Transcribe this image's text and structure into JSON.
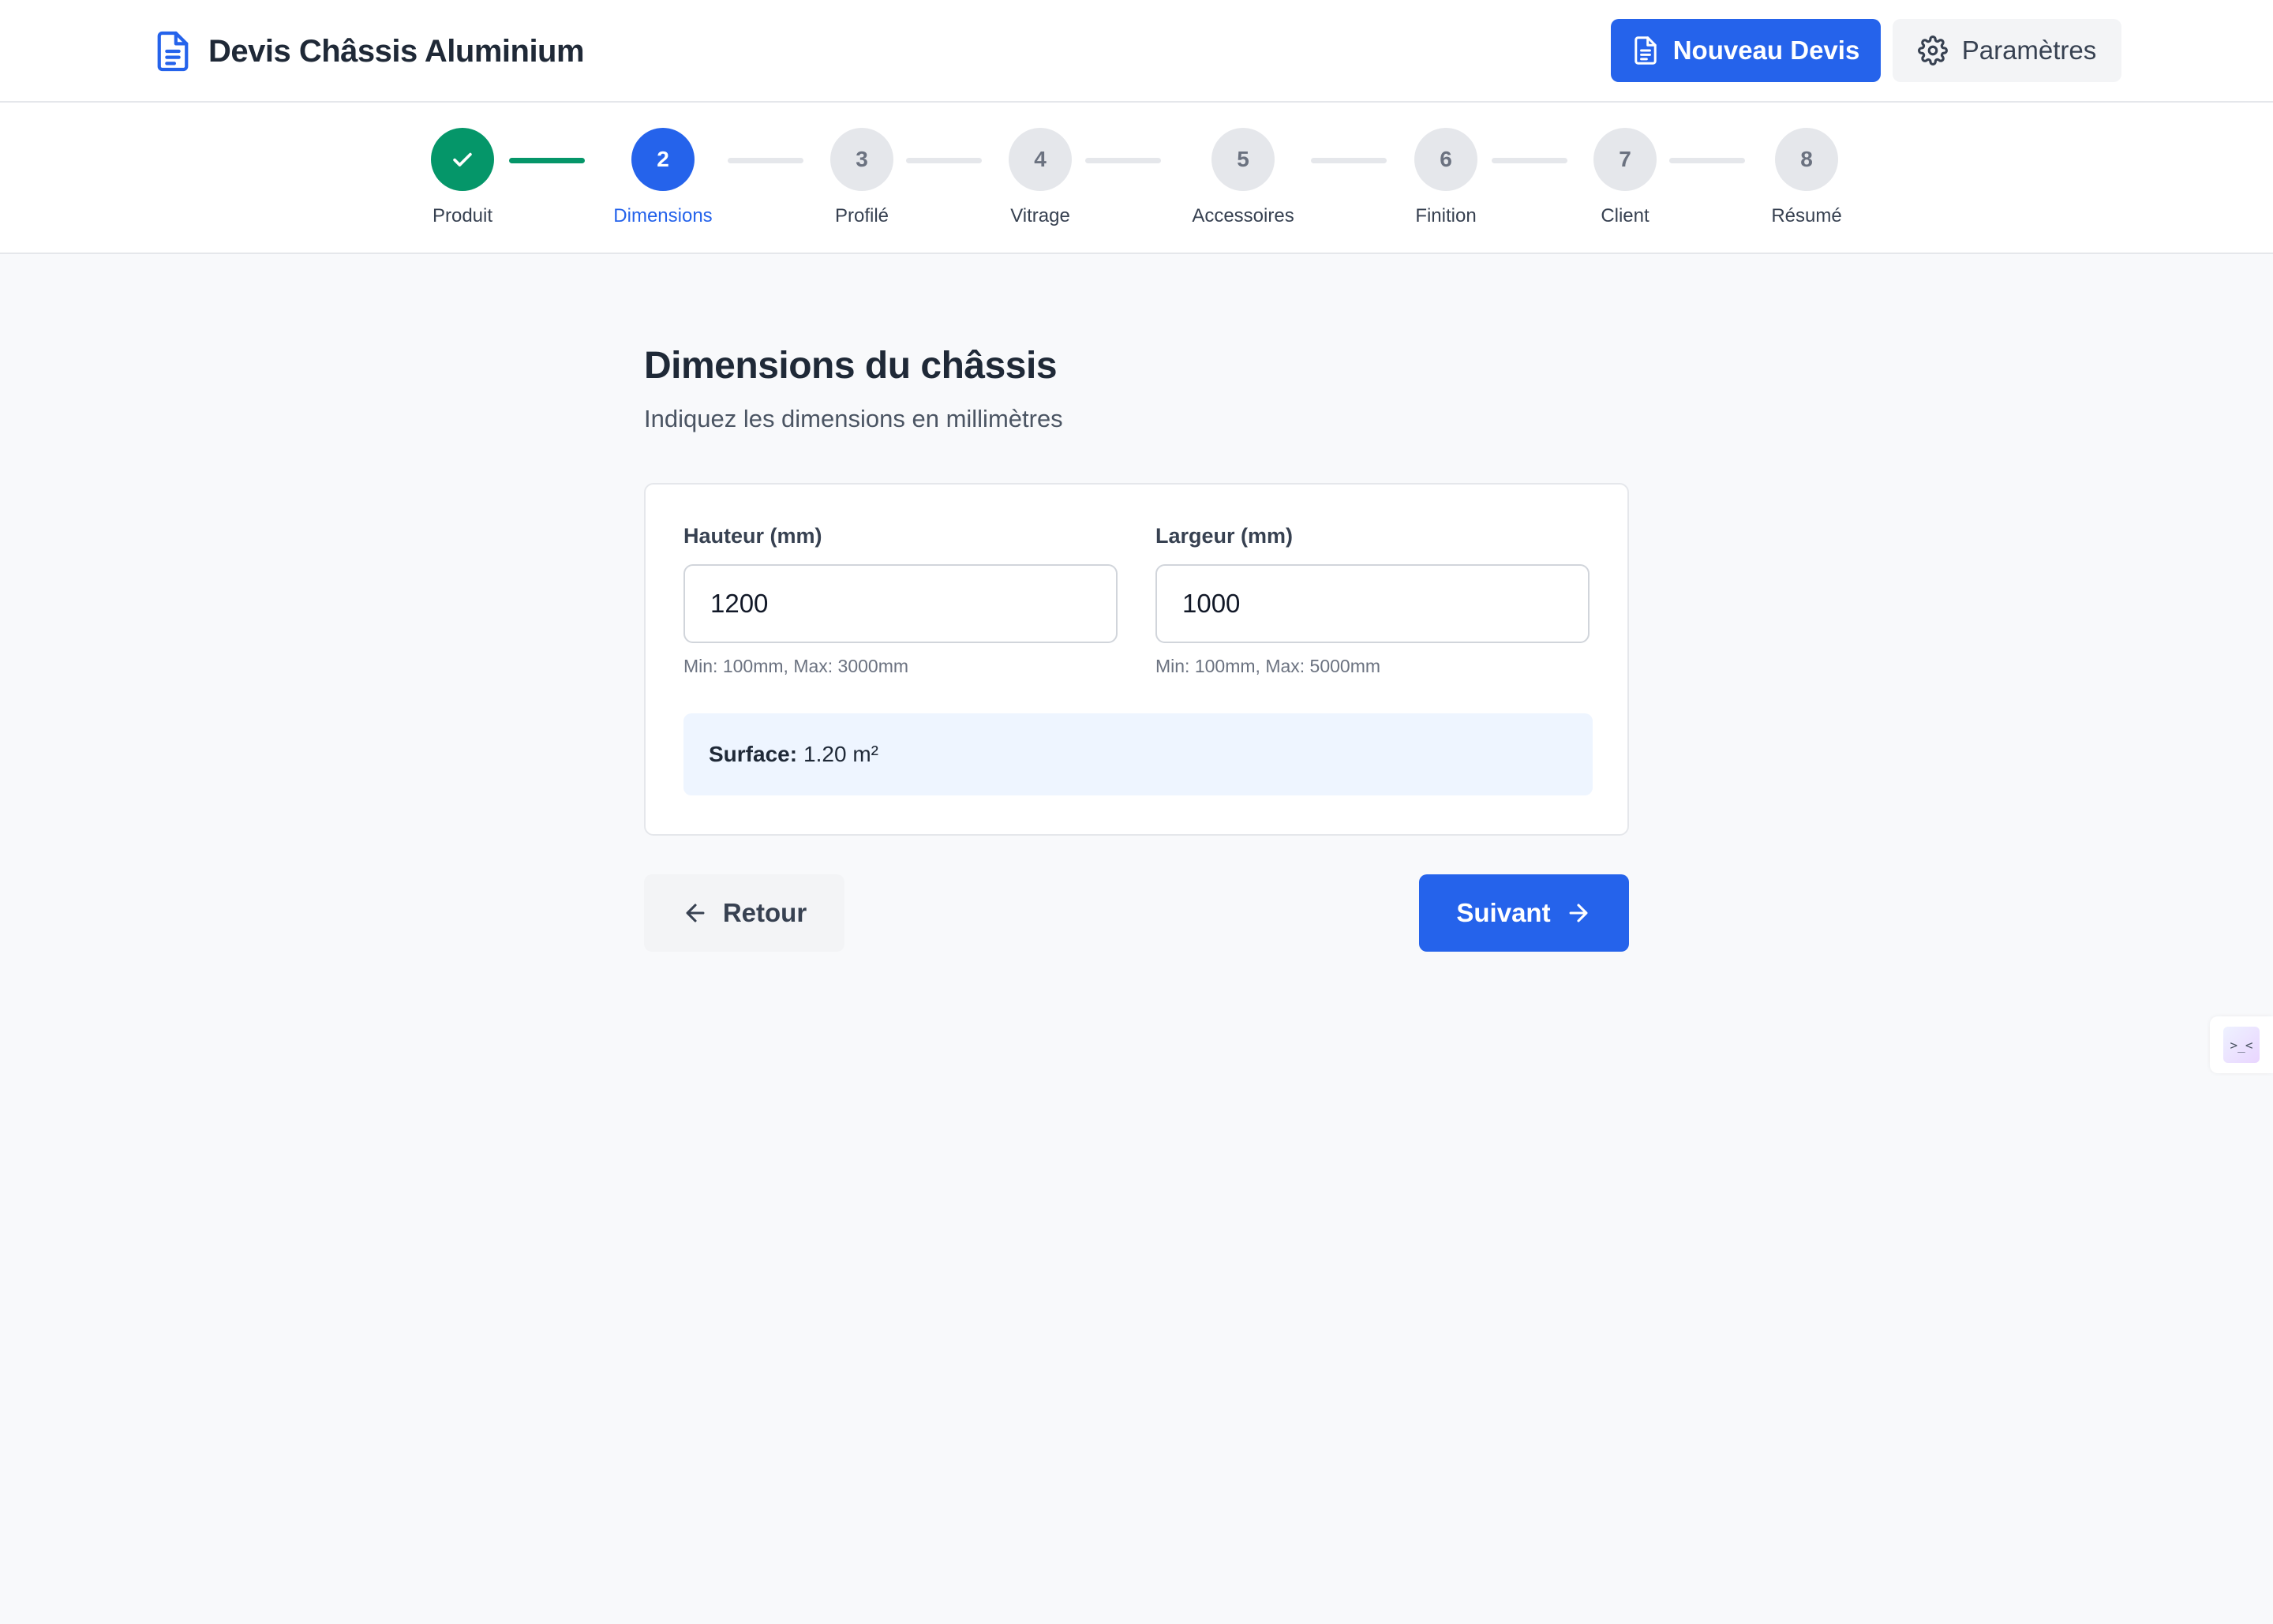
{
  "app": {
    "title": "Devis Châssis Aluminium",
    "logo_icon": "document-icon",
    "new_quote_label": "Nouveau Devis",
    "settings_label": "Paramètres"
  },
  "stepper": {
    "current_step": 2,
    "steps": [
      {
        "number": "1",
        "label": "Produit",
        "state": "done"
      },
      {
        "number": "2",
        "label": "Dimensions",
        "state": "active"
      },
      {
        "number": "3",
        "label": "Profilé",
        "state": "pending"
      },
      {
        "number": "4",
        "label": "Vitrage",
        "state": "pending"
      },
      {
        "number": "5",
        "label": "Accessoires",
        "state": "pending"
      },
      {
        "number": "6",
        "label": "Finition",
        "state": "pending"
      },
      {
        "number": "7",
        "label": "Client",
        "state": "pending"
      },
      {
        "number": "8",
        "label": "Résumé",
        "state": "pending"
      }
    ]
  },
  "form": {
    "title": "Dimensions du châssis",
    "subtitle": "Indiquez les dimensions en millimètres",
    "height": {
      "label": "Hauteur (mm)",
      "value": "1200",
      "hint": "Min: 100mm, Max: 3000mm"
    },
    "width": {
      "label": "Largeur (mm)",
      "value": "1000",
      "hint": "Min: 100mm, Max: 5000mm"
    },
    "surface": {
      "label": "Surface:",
      "value": "1.20 m²"
    }
  },
  "nav": {
    "back_label": "Retour",
    "next_label": "Suivant"
  },
  "widget": {
    "glyph": ">_<"
  },
  "colors": {
    "primary": "#2563eb",
    "success": "#059669",
    "muted": "#e5e7eb",
    "background": "#f8f9fb",
    "surface_bg": "#eef5ff"
  }
}
